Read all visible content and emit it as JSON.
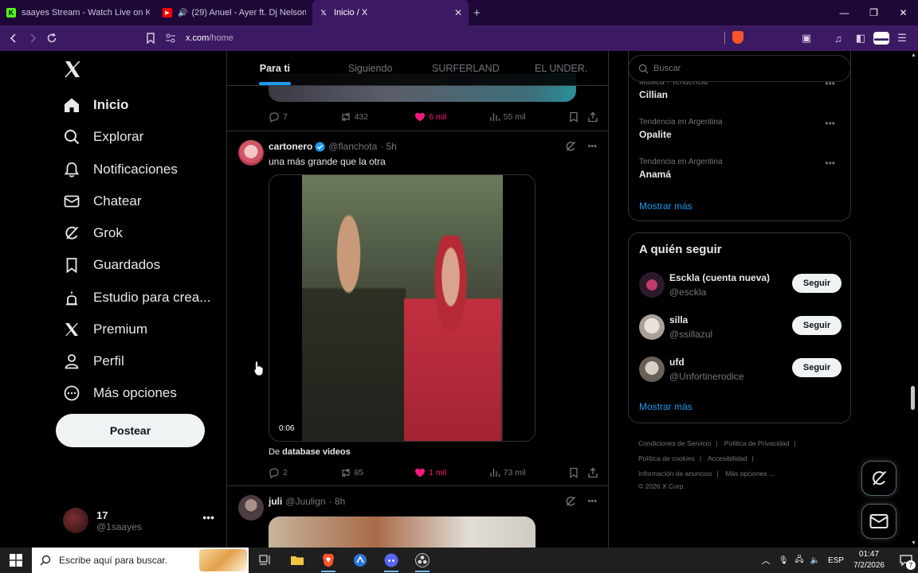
{
  "browser": {
    "tabs": [
      {
        "title": "saayes Stream - Watch Live on Kick",
        "active": false
      },
      {
        "title": "(29) Anuel - Ayer ft. Dj Nelson [O",
        "active": false
      },
      {
        "title": "Inicio / X",
        "active": true
      }
    ],
    "url_host": "x.com",
    "url_path": "/home"
  },
  "nav": {
    "items": [
      {
        "label": "Inicio"
      },
      {
        "label": "Explorar"
      },
      {
        "label": "Notificaciones"
      },
      {
        "label": "Chatear"
      },
      {
        "label": "Grok"
      },
      {
        "label": "Guardados"
      },
      {
        "label": "Estudio para crea..."
      },
      {
        "label": "Premium"
      },
      {
        "label": "Perfil"
      },
      {
        "label": "Más opciones"
      }
    ],
    "post_button": "Postear",
    "account": {
      "name": "17",
      "handle": "@1saayes"
    }
  },
  "feed": {
    "tabs": [
      "Para ti",
      "Siguiendo",
      "SURFERLAND",
      "EL UNDER."
    ],
    "prev_post_actions": {
      "replies": "7",
      "reposts": "432",
      "likes": "6 mil",
      "views": "55 mil"
    },
    "post": {
      "name": "cartonero",
      "handle": "@flanchota",
      "time": "· 5h",
      "text": "una más grande que la otra",
      "video_duration": "0:06",
      "source_prefix": "De",
      "source_name": "database videos",
      "replies": "2",
      "reposts": "85",
      "likes": "1 mil",
      "views": "73 mil"
    },
    "next_post": {
      "name": "juli",
      "handle": "@Juulign",
      "time": "· 8h"
    }
  },
  "sidebar": {
    "search_placeholder": "Buscar",
    "trends": [
      {
        "context": "Música · Tendencia",
        "name": "Cillian"
      },
      {
        "context": "Tendencia en Argentina",
        "name": "Opalite"
      },
      {
        "context": "Tendencia en Argentina",
        "name": "Anamá"
      }
    ],
    "trends_show_more": "Mostrar más",
    "who_to_follow_title": "A quién seguir",
    "who_to_follow": [
      {
        "name": "Esckla (cuenta nueva)",
        "handle": "@esckla",
        "button": "Seguir"
      },
      {
        "name": "silla",
        "handle": "@ssillazul",
        "button": "Seguir"
      },
      {
        "name": "ufd",
        "handle": "@Unfortinerodice",
        "button": "Seguir"
      }
    ],
    "follow_show_more": "Mostrar más",
    "footer": {
      "terms": "Condiciones de Servicio",
      "privacy": "Política de Privacidad",
      "cookies": "Política de cookies",
      "accessibility": "Accesibilidad",
      "ads": "Información de anuncios",
      "more": "Más opciones ...",
      "copyright": "© 2026 X Corp."
    }
  },
  "taskbar": {
    "search_placeholder": "Escribe aquí para buscar.",
    "language": "ESP",
    "time": "01:47",
    "date": "7/2/2026",
    "notification_count": "7"
  },
  "colors": {
    "accent": "#1d9bf0",
    "like": "#f91880",
    "browser_bg": "#3b1a63"
  }
}
